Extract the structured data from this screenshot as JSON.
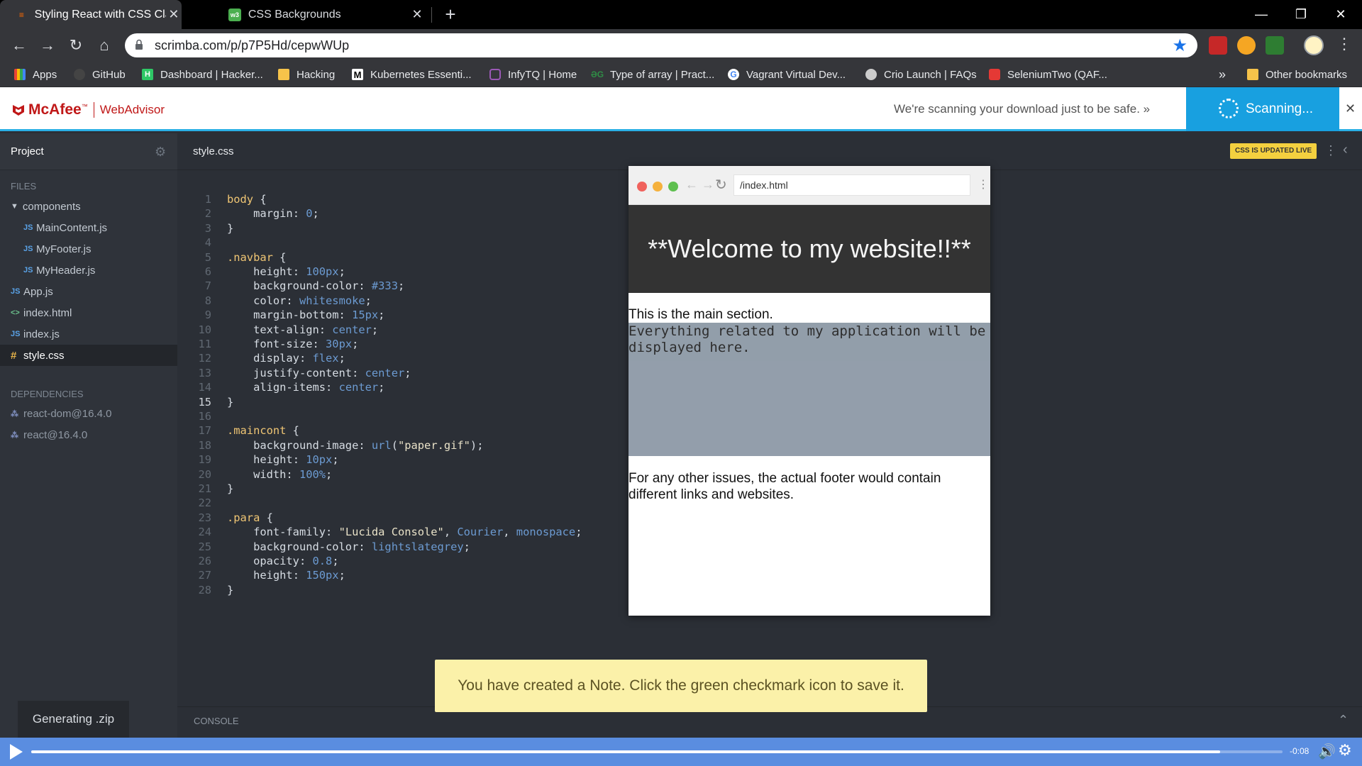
{
  "tabs": [
    {
      "title": "Styling React with CSS Classes - Scrimba",
      "active": true,
      "favicon_color": "#ff6a00"
    },
    {
      "title": "CSS Backgrounds",
      "active": false,
      "favicon_color": "#4caf50"
    }
  ],
  "address_bar": {
    "url": "scrimba.com/p/p7P5Hd/cepwWUp"
  },
  "bookmarks": [
    {
      "label": "Apps",
      "icon": "apps-grid-icon"
    },
    {
      "label": "GitHub",
      "icon": "github-icon"
    },
    {
      "label": "Dashboard | Hacker...",
      "icon": "hackerrank-icon"
    },
    {
      "label": "Hacking",
      "icon": "folder-icon"
    },
    {
      "label": "Kubernetes Essenti...",
      "icon": "medium-icon"
    },
    {
      "label": "InfyTQ | Home",
      "icon": "infytq-icon"
    },
    {
      "label": "Type of array | Pract...",
      "icon": "gfg-icon"
    },
    {
      "label": "Vagrant Virtual Dev...",
      "icon": "google-icon"
    },
    {
      "label": "Crio Launch | FAQs",
      "icon": "crio-icon"
    },
    {
      "label": "SeleniumTwo (QAF...",
      "icon": "selenium-icon"
    }
  ],
  "bookmarks_overflow": "»",
  "other_bookmarks": "Other bookmarks",
  "mcafee": {
    "brand": "McAfee",
    "tm": "™",
    "product": "WebAdvisor",
    "message": "We're scanning your download just to be safe. »",
    "scan_label": "Scanning..."
  },
  "sidebar": {
    "project_label": "Project",
    "files_label": "FILES",
    "files": [
      {
        "name": "components",
        "type": "folder",
        "depth": 0
      },
      {
        "name": "MainContent.js",
        "type": "js",
        "depth": 1
      },
      {
        "name": "MyFooter.js",
        "type": "js",
        "depth": 1
      },
      {
        "name": "MyHeader.js",
        "type": "js",
        "depth": 1
      },
      {
        "name": "App.js",
        "type": "js",
        "depth": 0
      },
      {
        "name": "index.html",
        "type": "html",
        "depth": 0
      },
      {
        "name": "index.js",
        "type": "js",
        "depth": 0
      },
      {
        "name": "style.css",
        "type": "css",
        "depth": 0,
        "selected": true
      }
    ],
    "deps_label": "DEPENDENCIES",
    "dependencies": [
      "react-dom@16.4.0",
      "react@16.4.0"
    ]
  },
  "editor": {
    "filename": "style.css",
    "live_badge": "CSS IS UPDATED LIVE",
    "current_line": 15,
    "lines": [
      "body {",
      "    margin: 0;",
      "}",
      "",
      ".navbar {",
      "    height: 100px;",
      "    background-color: #333;",
      "    color: whitesmoke;",
      "    margin-bottom: 15px;",
      "    text-align: center;",
      "    font-size: 30px;",
      "    display: flex;",
      "    justify-content: center;",
      "    align-items: center;",
      "}",
      "",
      ".maincont {",
      "    background-image: url(\"paper.gif\");",
      "    height: 10px;",
      "    width: 100%;",
      "}",
      "",
      ".para {",
      "    font-family: \"Lucida Console\", Courier, monospace;",
      "    background-color: lightslategrey;",
      "    opacity: 0.8;",
      "    height: 150px;",
      "}"
    ]
  },
  "preview": {
    "url": "/index.html",
    "header": "**Welcome to my website!!**",
    "main": "This is the main section.",
    "para": "Everything related to my application will be displayed here.",
    "footer": "For any other issues, the actual footer would contain different links and websites."
  },
  "console_label": "CONSOLE",
  "toast": "You have created a Note. Click the green checkmark icon to save it.",
  "generating": "Generating .zip",
  "player": {
    "time": "-0:08",
    "progress": 0.95
  }
}
